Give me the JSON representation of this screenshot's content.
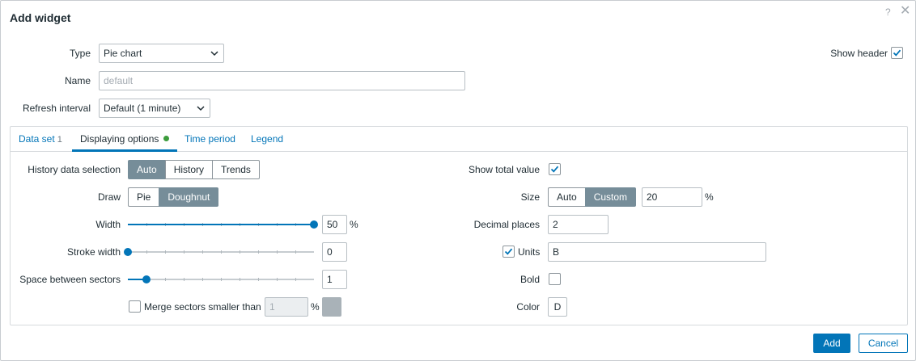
{
  "dialog": {
    "title": "Add widget",
    "help_glyph": "?",
    "close_glyph": "✕"
  },
  "form": {
    "type_label": "Type",
    "type_value": "Pie chart",
    "name_label": "Name",
    "name_placeholder": "default",
    "refresh_label": "Refresh interval",
    "refresh_value": "Default (1 minute)",
    "show_header_label": "Show header",
    "show_header_checked": true
  },
  "tabs": [
    {
      "label": "Data set",
      "count": "1"
    },
    {
      "label": "Displaying options",
      "active": true,
      "indicator": "green-dot"
    },
    {
      "label": "Time period"
    },
    {
      "label": "Legend"
    }
  ],
  "left": {
    "history_label": "History data selection",
    "history_options": [
      "Auto",
      "History",
      "Trends"
    ],
    "history_selected": "Auto",
    "draw_label": "Draw",
    "draw_options": [
      "Pie",
      "Doughnut"
    ],
    "draw_selected": "Doughnut",
    "width_label": "Width",
    "width_value": "50",
    "width_unit": "%",
    "width_fraction": 1.0,
    "stroke_label": "Stroke width",
    "stroke_value": "0",
    "stroke_fraction": 0.0,
    "space_label": "Space between sectors",
    "space_value": "1",
    "space_fraction": 0.1,
    "merge_label": "Merge sectors smaller than",
    "merge_checked": false,
    "merge_value": "1",
    "merge_unit": "%"
  },
  "right": {
    "total_label": "Show total value",
    "total_checked": true,
    "size_label": "Size",
    "size_options": [
      "Auto",
      "Custom"
    ],
    "size_selected": "Custom",
    "size_value": "20",
    "size_unit": "%",
    "decimal_label": "Decimal places",
    "decimal_value": "2",
    "units_label": "Units",
    "units_checked": true,
    "units_value": "B",
    "bold_label": "Bold",
    "bold_checked": false,
    "color_label": "Color",
    "color_value": "D"
  },
  "footer": {
    "add_label": "Add",
    "cancel_label": "Cancel"
  },
  "colors": {
    "accent": "#0275b8",
    "segment_selected": "#768d99",
    "indicator": "#3c9c3c"
  }
}
